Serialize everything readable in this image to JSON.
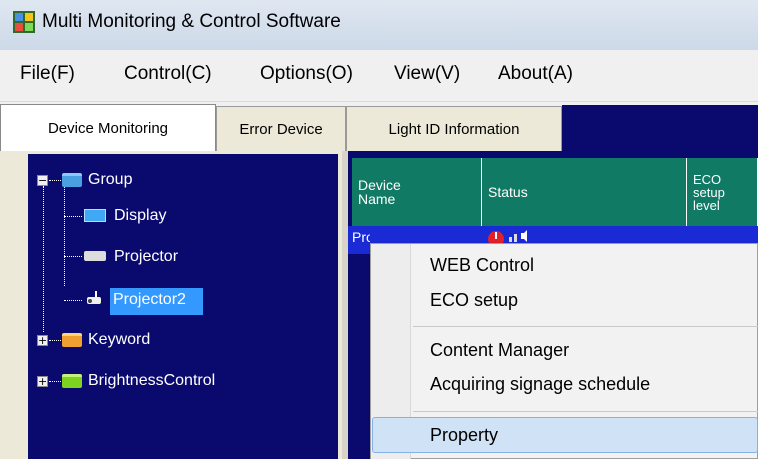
{
  "window": {
    "title": "Multi Monitoring & Control Software"
  },
  "menu": [
    "File(F)",
    "Control(C)",
    "Options(O)",
    "View(V)",
    "About(A)"
  ],
  "tabs": [
    "Device Monitoring",
    "Error Device",
    "Light ID Information"
  ],
  "tree": {
    "group": "Group",
    "children": [
      "Display",
      "Projector",
      "Projector2"
    ],
    "keyword": "Keyword",
    "brightness": "BrightnessControl"
  },
  "table": {
    "headers": {
      "device_name": "Device\nName",
      "status": "Status",
      "eco": "ECO\nsetup\nlevel"
    },
    "selected_row_device": "Projector2"
  },
  "context_menu": {
    "items": [
      "WEB Control",
      "ECO setup",
      "Content Manager",
      "Acquiring signage schedule",
      "Property"
    ]
  },
  "colors": {
    "tree_bg": "#0a0a6e",
    "header_bg": "#117a65",
    "selection": "#3399ff",
    "hover": "#cfe2f6"
  }
}
